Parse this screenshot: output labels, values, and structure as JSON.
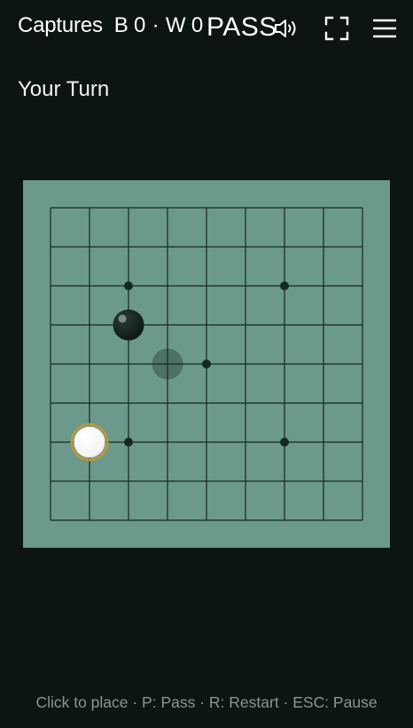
{
  "header": {
    "captures_label": "Captures",
    "black_label": "B",
    "black_captures": "0",
    "separator": "·",
    "white_label": "W",
    "white_captures": "0",
    "pass_label": "PASS"
  },
  "icons": {
    "sound": "speaker-icon",
    "fullscreen": "fullscreen-icon",
    "menu": "hamburger-menu-icon"
  },
  "status": {
    "turn_text": "Your Turn"
  },
  "board": {
    "size": 9,
    "star_points": [
      [
        2,
        2
      ],
      [
        6,
        2
      ],
      [
        4,
        4
      ],
      [
        2,
        6
      ],
      [
        6,
        6
      ]
    ],
    "stones": [
      {
        "color": "black",
        "col": 2,
        "row": 3
      },
      {
        "color": "white",
        "col": 1,
        "row": 6
      }
    ],
    "hover_preview": {
      "col": 3,
      "row": 4
    },
    "colors": {
      "board": "#6b998b",
      "lines": "#142824",
      "background": "#0c1514",
      "black_stone": "#0e1a18",
      "white_stone": "#ffffff",
      "last_move_ring": "#b9973f"
    }
  },
  "footer": {
    "hint": "Click to place · P: Pass · R: Restart · ESC: Pause"
  }
}
